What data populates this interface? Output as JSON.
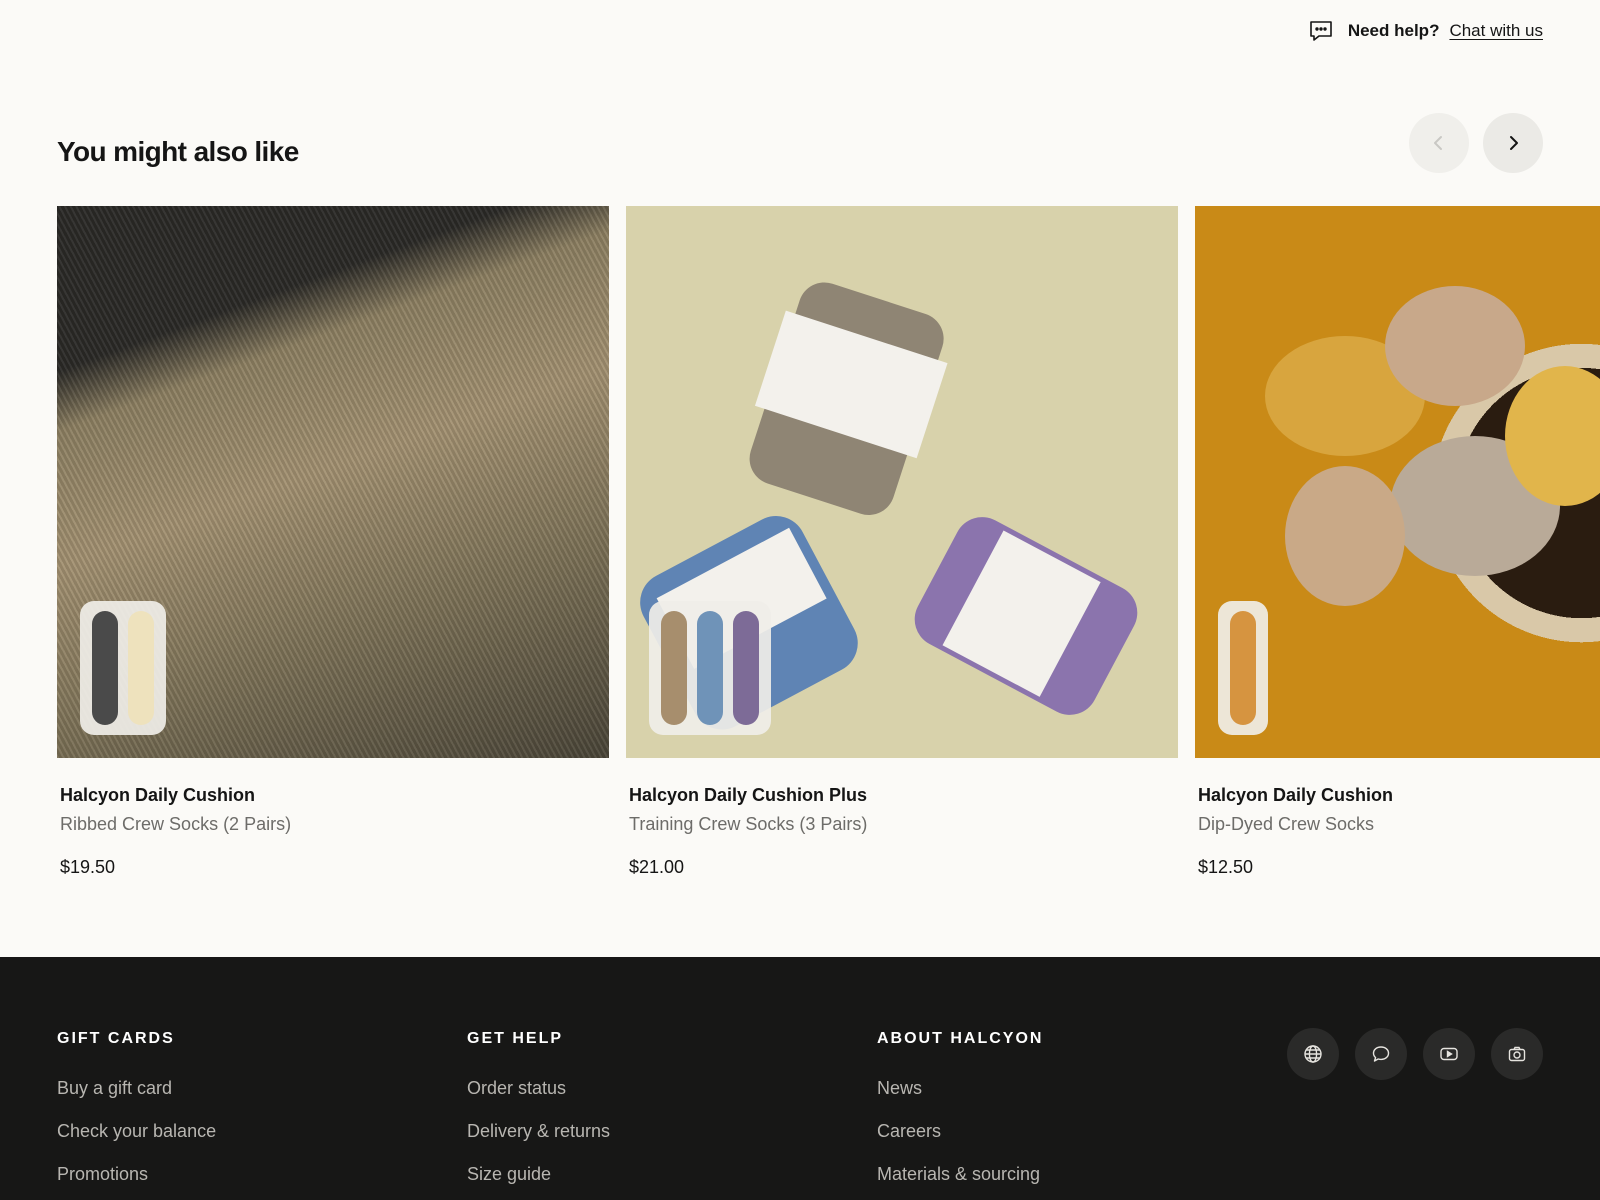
{
  "help": {
    "need_label": "Need help?",
    "chat_link": "Chat with us"
  },
  "section": {
    "title": "You might also like"
  },
  "products": [
    {
      "name": "Halcyon Daily Cushion",
      "desc": "Ribbed Crew Socks (2 Pairs)",
      "price": "$19.50",
      "swatches": [
        "#4a4a4a",
        "#eee2bd"
      ]
    },
    {
      "name": "Halcyon Daily Cushion Plus",
      "desc": "Training Crew Socks (3 Pairs)",
      "price": "$21.00",
      "swatches": [
        "#a78e6d",
        "#6f93b8",
        "#7d6b97"
      ]
    },
    {
      "name": "Halcyon Daily Cushion",
      "desc": "Dip-Dyed Crew Socks",
      "price": "$12.50",
      "swatches": [
        "#d69440"
      ]
    }
  ],
  "footer": {
    "gift": {
      "title": "GIFT CARDS",
      "links": [
        "Buy a gift card",
        "Check your balance",
        "Promotions"
      ]
    },
    "help": {
      "title": "GET HELP",
      "links": [
        "Order status",
        "Delivery & returns",
        "Size guide"
      ]
    },
    "about": {
      "title": "ABOUT HALCYON",
      "links": [
        "News",
        "Careers",
        "Materials & sourcing"
      ]
    },
    "social_icons": [
      "globe-icon",
      "speech-bubble-icon",
      "play-icon",
      "camera-icon"
    ]
  }
}
